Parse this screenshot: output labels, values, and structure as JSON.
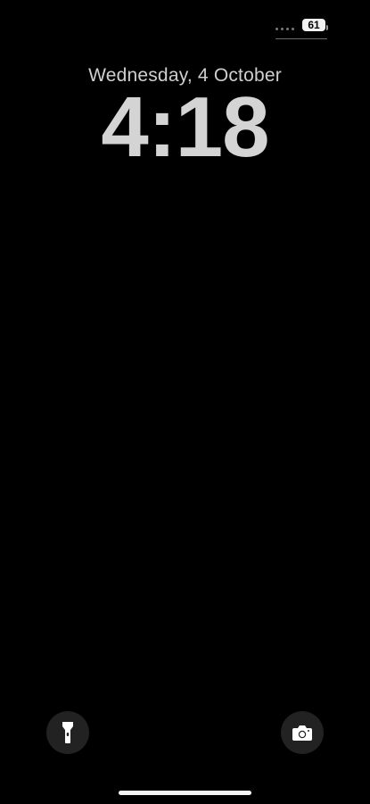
{
  "status_bar": {
    "battery_level": "61",
    "signal_strength_icon": "signal-dots-icon",
    "colors": {
      "battery_fill": "#f2f2f2",
      "signal": "#7a7a7a"
    }
  },
  "lock_screen": {
    "date": "Wednesday, 4 October",
    "time": "4:18"
  },
  "quick_actions": {
    "left_icon": "flashlight-icon",
    "right_icon": "camera-icon"
  },
  "theme": {
    "background": "#000000",
    "text": "#d4d4d4",
    "button_bg": "#222222"
  }
}
